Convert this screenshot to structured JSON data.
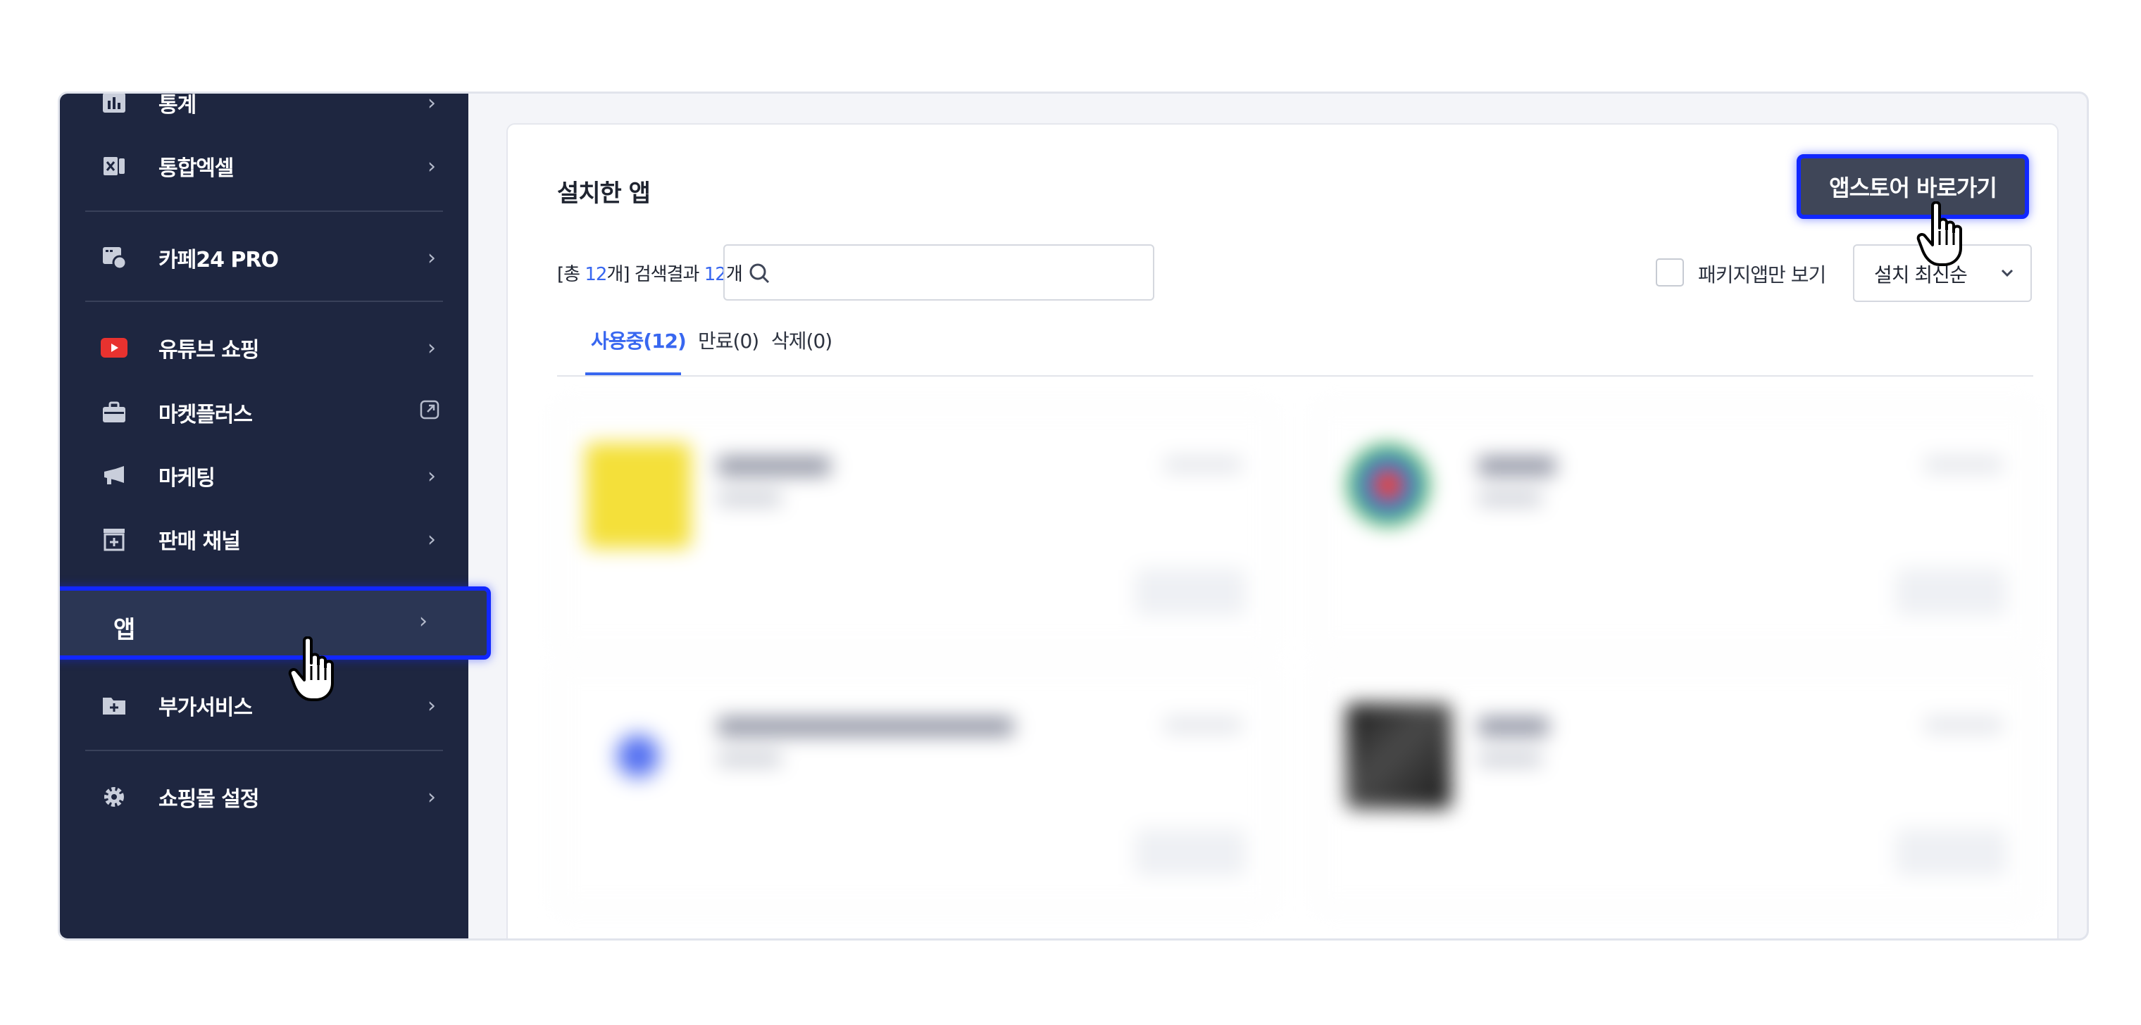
{
  "sidebar": {
    "items": [
      {
        "label": "통계",
        "icon": "chart-icon",
        "trail": "›"
      },
      {
        "label": "통합엑셀",
        "icon": "excel-icon",
        "trail": "›"
      },
      {
        "label": "카페24 PRO",
        "icon": "pro-icon",
        "trail": "›"
      },
      {
        "label": "유튜브 쇼핑",
        "icon": "youtube-icon",
        "trail": "›"
      },
      {
        "label": "마켓플러스",
        "icon": "briefcase-icon",
        "trail": "external-link-icon"
      },
      {
        "label": "마케팅",
        "icon": "megaphone-icon",
        "trail": "›"
      },
      {
        "label": "판매 채널",
        "icon": "store-icon",
        "trail": "›"
      },
      {
        "label": "앱",
        "icon": "apps-grid-icon",
        "trail": "›",
        "active": true
      },
      {
        "label": "부가서비스",
        "icon": "folder-plus-icon",
        "trail": "›"
      },
      {
        "label": "쇼핑몰 설정",
        "icon": "gear-icon",
        "trail": "›"
      }
    ],
    "chevron": "›"
  },
  "main": {
    "title": "설치한 앱",
    "store_button": "앱스토어 바로가기",
    "count": {
      "prefix": "[총 ",
      "total": "12",
      "mid": "개] 검색결과 ",
      "results": "12",
      "suffix": "개"
    },
    "search": {
      "placeholder": ""
    },
    "package_only_label": "패키지앱만 보기",
    "sort": {
      "selected": "설치 최신순"
    },
    "tabs": [
      {
        "label": "사용중(12)",
        "active": true
      },
      {
        "label": "만료(0)"
      },
      {
        "label": "삭제(0)"
      }
    ]
  },
  "colors": {
    "sidebar": "#1e2640",
    "accent": "#3867f0",
    "highlight": "#1127ff"
  }
}
